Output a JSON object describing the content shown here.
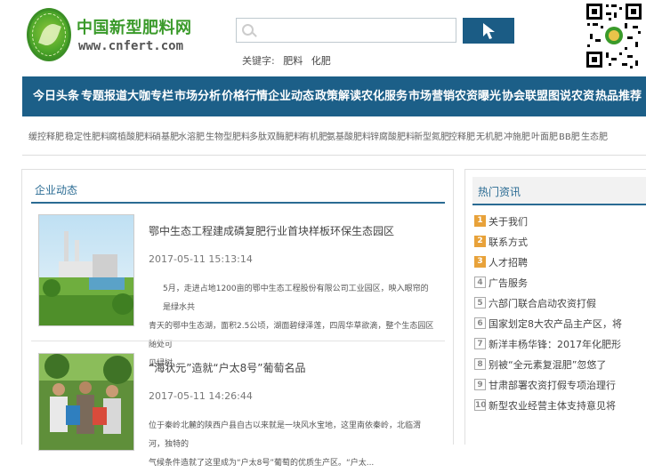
{
  "header": {
    "logo_text": "中国新型肥料网",
    "logo_url": "www.cnfert.com",
    "keywords_label": "关键字:",
    "keywords": [
      "肥料",
      "化肥"
    ],
    "search": {
      "placeholder": ""
    }
  },
  "nav": {
    "items": [
      "今日头条",
      "专题报道",
      "大咖专栏",
      "市场分析",
      "价格行情",
      "企业动态",
      "政策解读",
      "农化服务",
      "市场营销",
      "农资曝光",
      "协会联盟",
      "图说农资",
      "热品推荐"
    ]
  },
  "subnav": {
    "tags": [
      "缓控释肥",
      "稳定性肥料",
      "腐植酸肥料",
      "硝基肥",
      "水溶肥",
      "生物型肥料",
      "多肽双酶肥料",
      "有机肥",
      "氨基酸肥料",
      "锌腐酸肥料",
      "新型氮肥",
      "控释肥",
      "无机肥",
      "冲施肥",
      "叶面肥",
      "BB肥",
      "生态肥"
    ]
  },
  "main": {
    "section_title": "企业动态",
    "articles": [
      {
        "title": "鄂中生态工程建成磷复肥行业首块样板环保生态园区",
        "date": "2017-05-11 15:13:14",
        "lines": [
          "5月，走进占地1200亩的鄂中生态工程股份有限公司工业园区，映入眼帘的是绿水共",
          "青天的鄂中生态湖，面积2.5公顷，湖面碧绿泽莲，四周华草欲滴，整个生态园区随处可",
          "见绿树..."
        ]
      },
      {
        "title": "“海状元”造就“户太8号”葡萄名品",
        "date": "2017-05-11 14:26:44",
        "lines": [
          "位于秦岭北麓的陕西户县自古以来就是一块风水宝地，这里南依秦岭，北临渭河，独特的",
          "气候条件造就了这里成为“户太8号”葡萄的优质生产区。“户太..."
        ]
      }
    ]
  },
  "sidebar": {
    "title": "热门资讯",
    "items": [
      {
        "num": "1",
        "text": "关于我们"
      },
      {
        "num": "2",
        "text": "联系方式"
      },
      {
        "num": "3",
        "text": "人才招聘"
      },
      {
        "num": "4",
        "text": "广告服务"
      },
      {
        "num": "5",
        "text": "六部门联合启动农资打假"
      },
      {
        "num": "6",
        "text": "国家划定8大农产品主产区，将"
      },
      {
        "num": "7",
        "text": "新洋丰杨华锋：2017年化肥形"
      },
      {
        "num": "8",
        "text": "别被“全元素复混肥”忽悠了"
      },
      {
        "num": "9",
        "text": "甘肃部署农资打假专项治理行"
      },
      {
        "num": "10",
        "text": "新型农业经营主体支持意见将"
      }
    ]
  },
  "colors": {
    "nav_bg": "#1c5f88",
    "accent": "#2a6b93",
    "logo_green": "#3a9a2a",
    "badge_hot": "#e8a23a"
  }
}
